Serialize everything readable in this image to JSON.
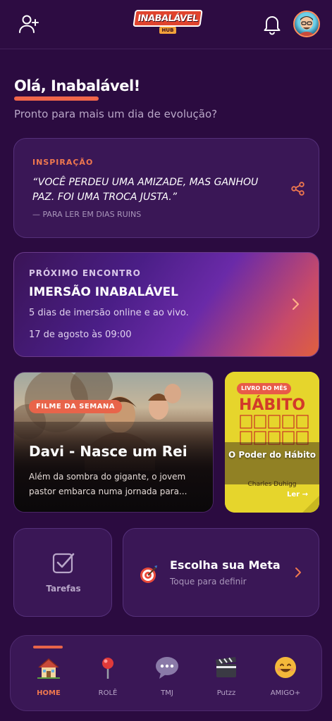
{
  "header": {
    "logo_text": "INABALÁVEL",
    "logo_sub": "HUB"
  },
  "greeting": {
    "title": "Olá, Inabalável!",
    "subtitle": "Pronto para mais um dia de evolução?"
  },
  "inspiration": {
    "tag": "INSPIRAÇÃO",
    "quote": "“VOCÊ PERDEU UMA AMIZADE, MAS GANHOU PAZ. FOI UMA TROCA JUSTA.”",
    "source": "— PARA LER EM DIAS RUINS"
  },
  "event": {
    "tag": "PRÓXIMO ENCONTRO",
    "title": "IMERSÃO INABALÁVEL",
    "description": "5 dias de imersão online e ao vivo.",
    "date": "17 de agosto às 09:00"
  },
  "movie": {
    "badge": "FILME DA SEMANA",
    "title": "Davi - Nasce um Rei",
    "description": "Além da sombra do gigante, o jovem pastor embarca numa jornada para..."
  },
  "book": {
    "badge": "LIVRO DO MÊS",
    "cover_title": "HÁBITO",
    "cover_author": "Charles Duhigg",
    "title": "O Poder do Hábito",
    "read_label": "Ler →"
  },
  "tasks": {
    "label": "Tarefas"
  },
  "goal": {
    "title": "Escolha sua Meta",
    "subtitle": "Toque para definir"
  },
  "nav": {
    "items": [
      {
        "label": "HOME",
        "icon": "house-icon",
        "active": true
      },
      {
        "label": "ROLÊ",
        "icon": "pin-icon",
        "active": false
      },
      {
        "label": "TMJ",
        "icon": "chat-bubble-icon",
        "active": false
      },
      {
        "label": "Putzz",
        "icon": "clapperboard-icon",
        "active": false
      },
      {
        "label": "AMIGO+",
        "icon": "smiley-icon",
        "active": false
      }
    ]
  },
  "colors": {
    "background": "#2b0b40",
    "card": "#3a1756",
    "accent": "#f0654a",
    "muted_text": "#b9a7c7"
  }
}
